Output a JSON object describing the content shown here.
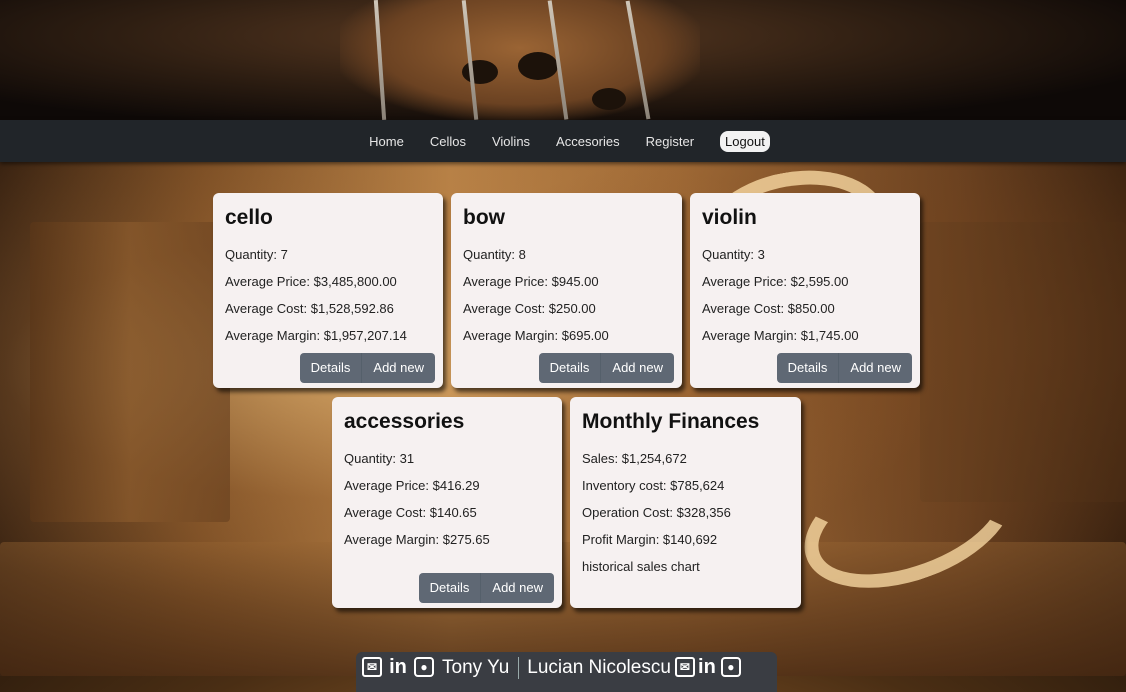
{
  "nav": {
    "items": [
      "Home",
      "Cellos",
      "Violins",
      "Accesories",
      "Register"
    ],
    "logout_label": "Logout"
  },
  "cards": [
    {
      "title": "cello",
      "lines": [
        "Quantity: 7",
        "Average Price: $3,485,800.00",
        "Average Cost: $1,528,592.86",
        "Average Margin: $1,957,207.14"
      ],
      "details_label": "Details",
      "add_label": "Add new"
    },
    {
      "title": "bow",
      "lines": [
        "Quantity: 8",
        "Average Price: $945.00",
        "Average Cost: $250.00",
        "Average Margin: $695.00"
      ],
      "details_label": "Details",
      "add_label": "Add new"
    },
    {
      "title": "violin",
      "lines": [
        "Quantity: 3",
        "Average Price: $2,595.00",
        "Average Cost: $850.00",
        "Average Margin: $1,745.00"
      ],
      "details_label": "Details",
      "add_label": "Add new"
    },
    {
      "title": "accessories",
      "lines": [
        "Quantity: 31",
        "Average Price: $416.29",
        "Average Cost: $140.65",
        "Average Margin: $275.65"
      ],
      "details_label": "Details",
      "add_label": "Add new"
    }
  ],
  "finances": {
    "title": "Monthly Finances",
    "lines": [
      "Sales: $1,254,672",
      "Inventory cost: $785,624",
      "Operation Cost: $328,356",
      "Profit Margin: $140,692",
      "historical sales chart"
    ]
  },
  "footer": {
    "people": [
      "Tony Yu",
      "Lucian Nicolescu"
    ],
    "icons": [
      "mail-icon",
      "linkedin-icon",
      "github-icon"
    ]
  }
}
